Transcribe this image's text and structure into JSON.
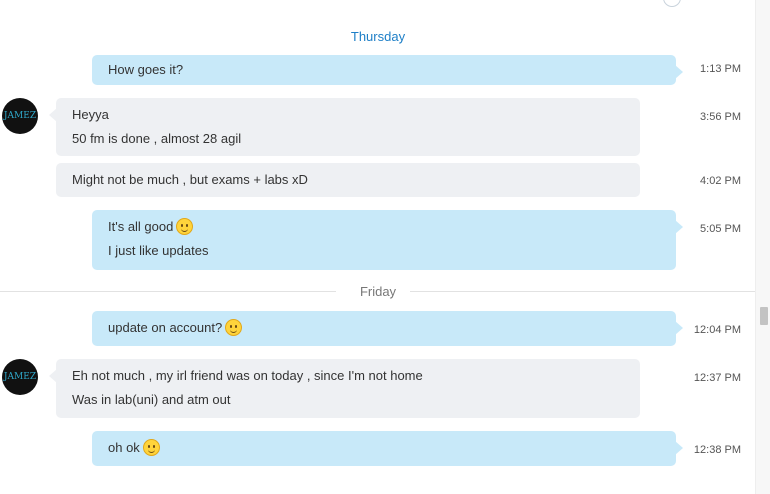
{
  "days": {
    "thursday": "Thursday",
    "friday": "Friday"
  },
  "contact": {
    "avatar_text": "JAMEZ"
  },
  "messages": [
    {
      "dir": "out",
      "lines": [
        "How goes it?"
      ],
      "time": "1:13 PM"
    },
    {
      "dir": "in",
      "lines": [
        "Heyya",
        "50 fm is done , almost 28 agil"
      ],
      "time": "3:56 PM"
    },
    {
      "dir": "in",
      "lines": [
        "Might not be much , but exams + labs xD"
      ],
      "time": "4:02 PM"
    },
    {
      "dir": "out",
      "lines": [
        "It's all good",
        "I just like updates"
      ],
      "time": "5:05 PM",
      "emoji_after_line": 0
    },
    {
      "dir": "out",
      "lines": [
        "update on account?"
      ],
      "time": "12:04 PM",
      "emoji_after_line": 0
    },
    {
      "dir": "in",
      "lines": [
        "Eh not much , my irl friend was on today , since I'm not home",
        "Was in lab(uni) and atm out"
      ],
      "time": "12:37 PM"
    },
    {
      "dir": "out",
      "lines": [
        "oh ok"
      ],
      "time": "12:38 PM",
      "emoji_after_line": 0
    }
  ]
}
